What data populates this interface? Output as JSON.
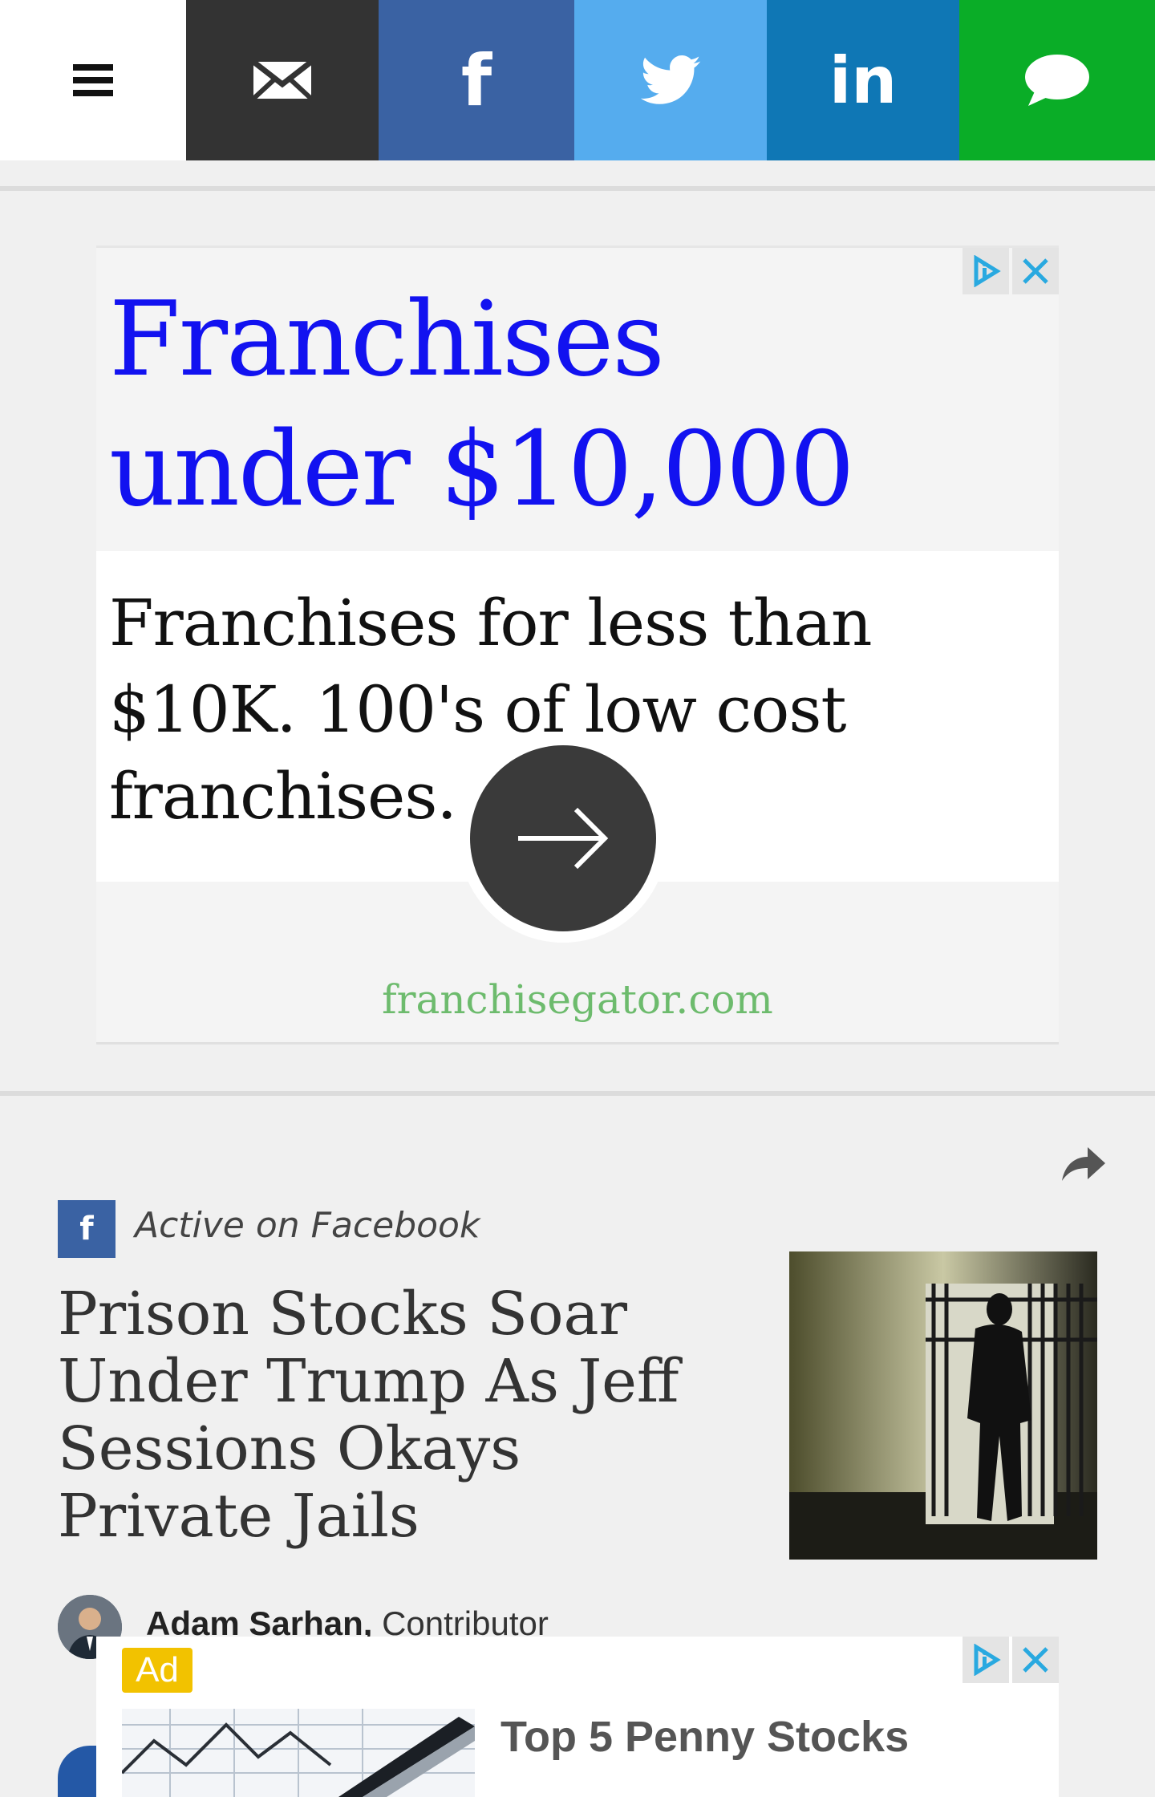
{
  "share_bar": {
    "menu_icon": "hamburger-menu-icon",
    "buttons": [
      {
        "name": "email",
        "icon": "envelope-icon",
        "color": "#333333"
      },
      {
        "name": "facebook",
        "icon": "facebook-icon",
        "color": "#3a62a3"
      },
      {
        "name": "twitter",
        "icon": "twitter-bird-icon",
        "color": "#55acee"
      },
      {
        "name": "linkedin",
        "icon": "linkedin-icon",
        "color": "#0f77b5"
      },
      {
        "name": "sms",
        "icon": "chat-bubble-icon",
        "color": "#0aad27"
      }
    ],
    "facebook_glyph": "f",
    "linkedin_glyph": "in"
  },
  "ad1": {
    "headline": "Franchises under $10,000",
    "body": "Franchises for less than $10K. 100's of low cost franchises.",
    "domain": "franchisegator.com",
    "headline_color": "#1212f0",
    "domain_color": "#6dbb6d"
  },
  "article": {
    "source_badge_glyph": "f",
    "source_label": "Active on Facebook",
    "title": "Prison Stocks Soar Under Trump As Jeff Sessions Okays Private Jails",
    "author_name": "Adam Sarhan,",
    "author_role": " Contributor"
  },
  "ad2": {
    "badge": "Ad",
    "title": "Top 5 Penny Stocks"
  }
}
